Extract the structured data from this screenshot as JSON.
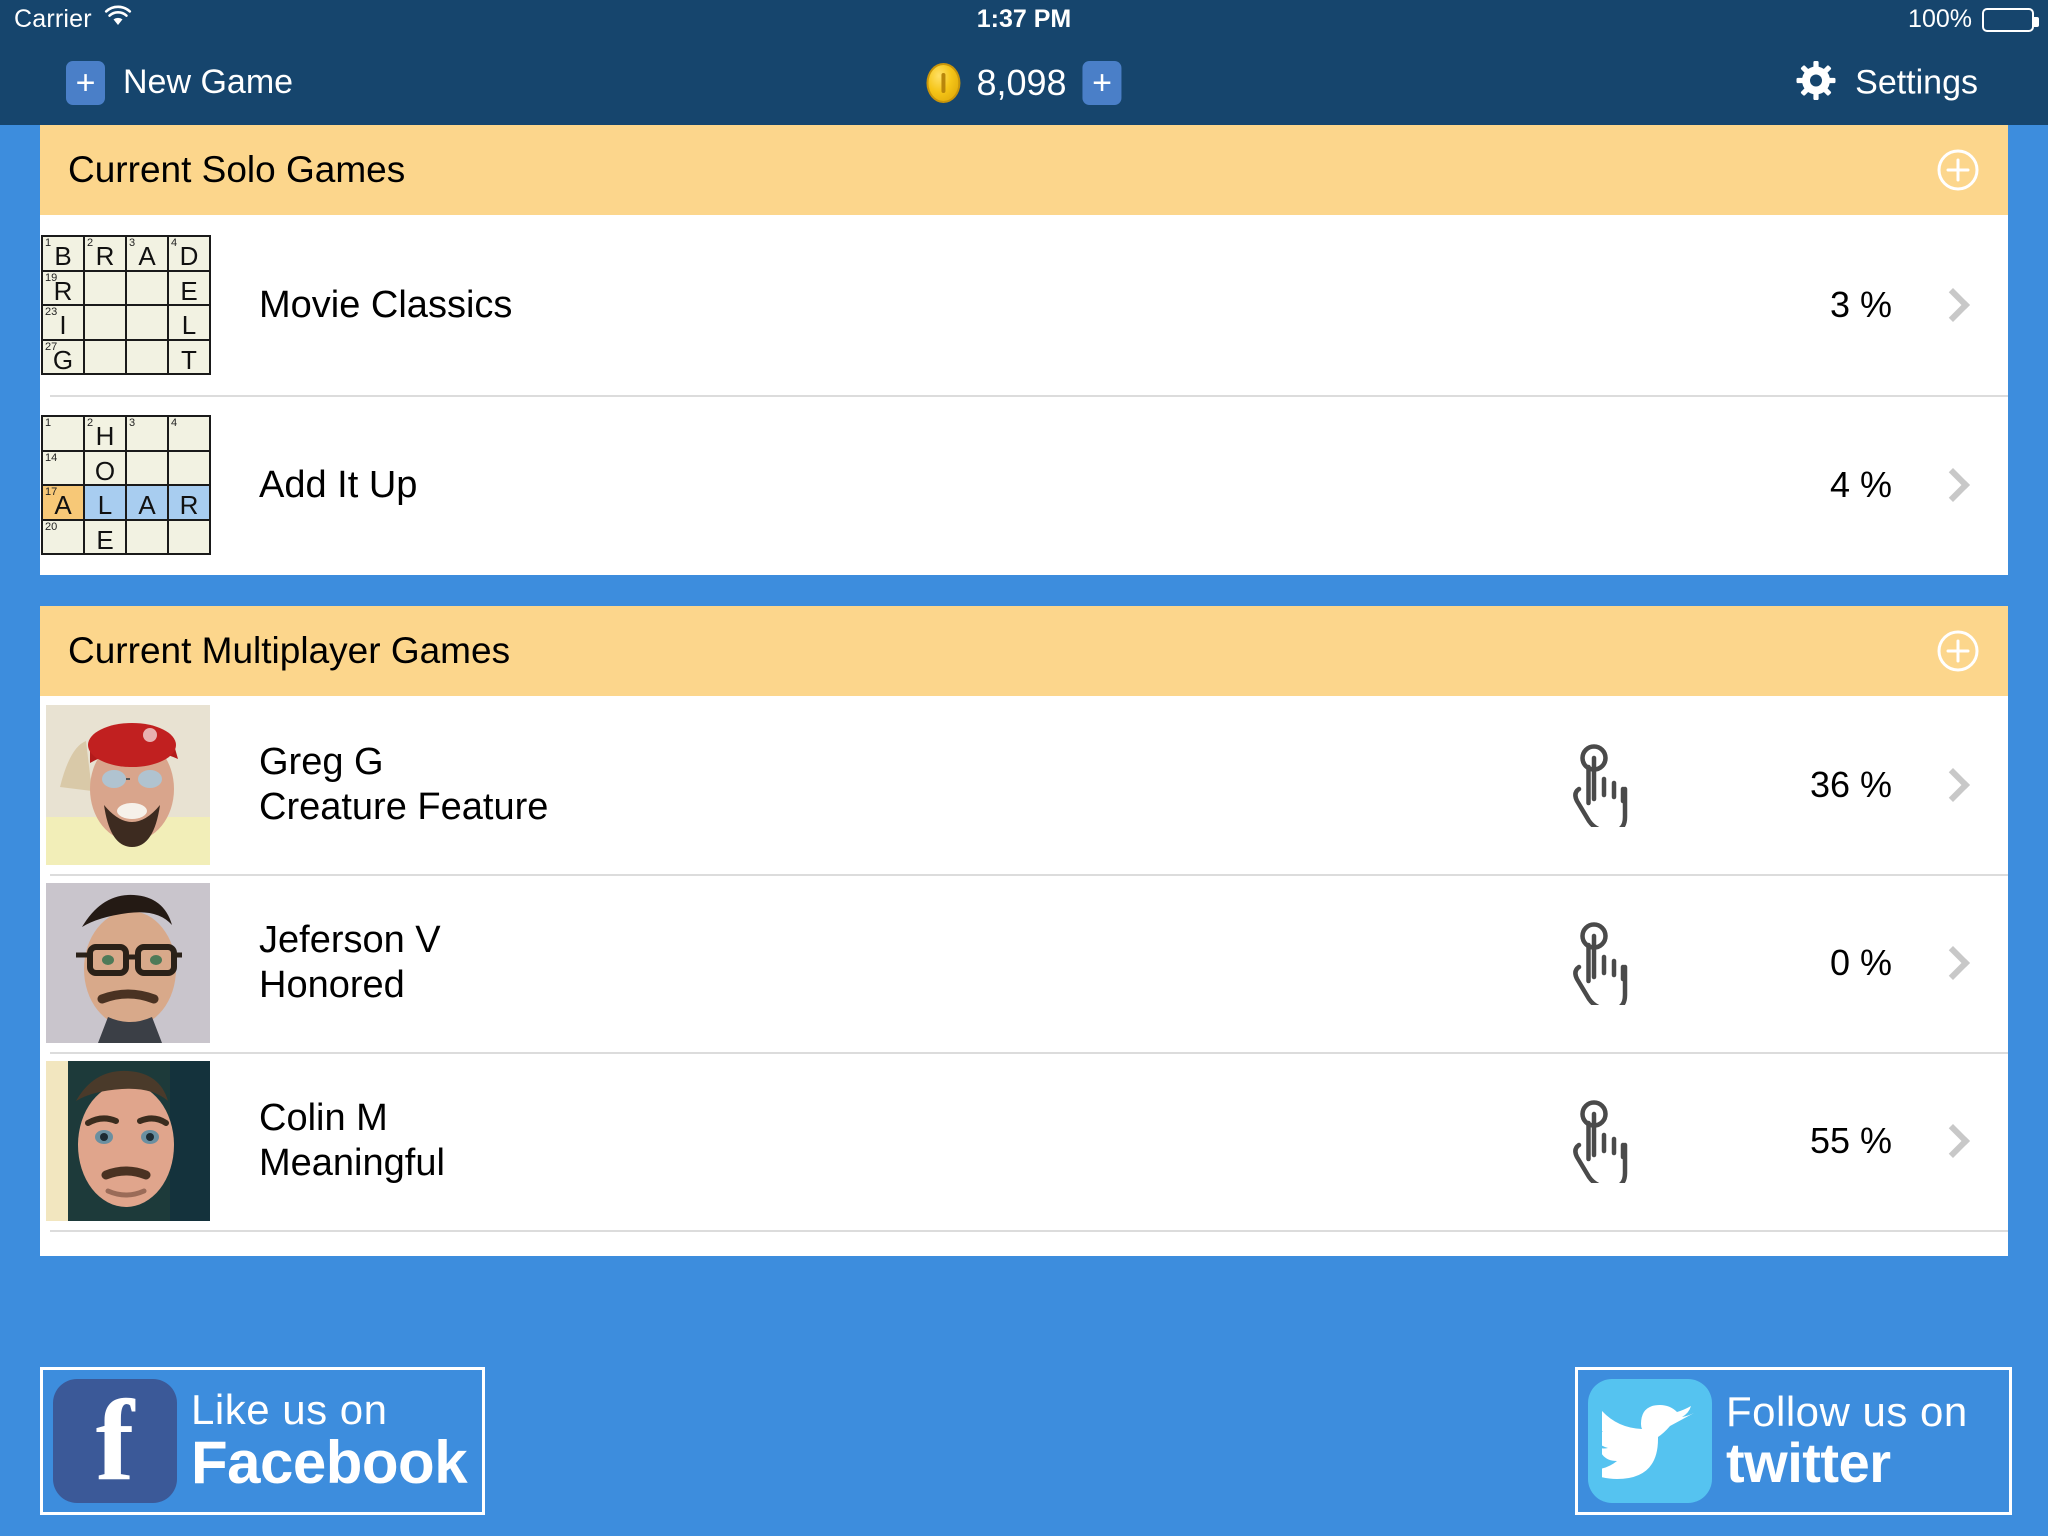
{
  "status_bar": {
    "carrier": "Carrier",
    "wifi_icon": "wifi-icon",
    "time": "1:37 PM",
    "battery_percent": "100%",
    "battery_icon": "battery-icon"
  },
  "nav_bar": {
    "new_game_label": "New Game",
    "new_game_icon": "plus-icon",
    "coin_icon": "coin-icon",
    "coin_count": "8,098",
    "coin_add_icon": "plus-icon",
    "settings_label": "Settings",
    "settings_icon": "gear-icon"
  },
  "colors": {
    "app_background": "#3d8ddd",
    "nav_background": "#16456d",
    "section_header": "#fcd68c",
    "row_background": "#ffffff",
    "cell_empty": "#f2f2e2",
    "cell_highlight_blue": "#a8cdf0",
    "cell_highlight_orange": "#f7c877",
    "chevron": "#c8c8c8",
    "facebook_blue": "#3b5998",
    "twitter_blue": "#55c3f0"
  },
  "sections": [
    {
      "title": "Current Solo Games",
      "add_icon": "plus-circle-icon",
      "rows": [
        {
          "thumbnail": "crossword-thumbnail",
          "title": "Movie Classics",
          "percent": "3 %",
          "chevron_icon": "chevron-right-icon",
          "grid": [
            [
              {
                "num": "1",
                "letter": "B"
              },
              {
                "num": "2",
                "letter": "R"
              },
              {
                "num": "3",
                "letter": "A"
              },
              {
                "num": "4",
                "letter": "D"
              }
            ],
            [
              {
                "num": "19",
                "letter": "R"
              },
              {
                "num": "",
                "letter": ""
              },
              {
                "num": "",
                "letter": ""
              },
              {
                "num": "",
                "letter": "E"
              }
            ],
            [
              {
                "num": "23",
                "letter": "I"
              },
              {
                "num": "",
                "letter": ""
              },
              {
                "num": "",
                "letter": ""
              },
              {
                "num": "",
                "letter": "L"
              }
            ],
            [
              {
                "num": "27",
                "letter": "G"
              },
              {
                "num": "",
                "letter": ""
              },
              {
                "num": "",
                "letter": ""
              },
              {
                "num": "",
                "letter": "T"
              }
            ]
          ]
        },
        {
          "thumbnail": "crossword-thumbnail",
          "title": "Add It Up",
          "percent": "4 %",
          "chevron_icon": "chevron-right-icon",
          "grid": [
            [
              {
                "num": "1",
                "letter": ""
              },
              {
                "num": "2",
                "letter": "H"
              },
              {
                "num": "3",
                "letter": ""
              },
              {
                "num": "4",
                "letter": ""
              }
            ],
            [
              {
                "num": "14",
                "letter": ""
              },
              {
                "num": "",
                "letter": "O"
              },
              {
                "num": "",
                "letter": ""
              },
              {
                "num": "",
                "letter": ""
              }
            ],
            [
              {
                "num": "17",
                "letter": "A",
                "hl": "orange"
              },
              {
                "num": "",
                "letter": "L",
                "hl": "blue"
              },
              {
                "num": "",
                "letter": "A",
                "hl": "blue"
              },
              {
                "num": "",
                "letter": "R",
                "hl": "blue"
              }
            ],
            [
              {
                "num": "20",
                "letter": ""
              },
              {
                "num": "",
                "letter": "E"
              },
              {
                "num": "",
                "letter": ""
              },
              {
                "num": "",
                "letter": ""
              }
            ]
          ]
        }
      ]
    },
    {
      "title": "Current Multiplayer Games",
      "add_icon": "plus-circle-icon",
      "rows": [
        {
          "avatar": "player-avatar",
          "player": "Greg G",
          "game": "Creature Feature",
          "turn_icon": "tap-hand-icon",
          "percent": "36 %",
          "chevron_icon": "chevron-right-icon"
        },
        {
          "avatar": "player-avatar",
          "player": "Jeferson V",
          "game": "Honored",
          "turn_icon": "tap-hand-icon",
          "percent": "0 %",
          "chevron_icon": "chevron-right-icon"
        },
        {
          "avatar": "player-avatar",
          "player": "Colin M",
          "game": "Meaningful",
          "turn_icon": "tap-hand-icon",
          "percent": "55 %",
          "chevron_icon": "chevron-right-icon"
        },
        {
          "avatar": "player-avatar",
          "player": "",
          "game": "",
          "turn_icon": "tap-hand-icon",
          "percent": "",
          "chevron_icon": "chevron-right-icon"
        }
      ]
    }
  ],
  "footer": {
    "facebook": {
      "icon": "facebook-logo-icon",
      "line1": "Like us on",
      "line2": "Facebook"
    },
    "twitter": {
      "icon": "twitter-bird-icon",
      "line1": "Follow us on",
      "line2": "twitter"
    }
  }
}
